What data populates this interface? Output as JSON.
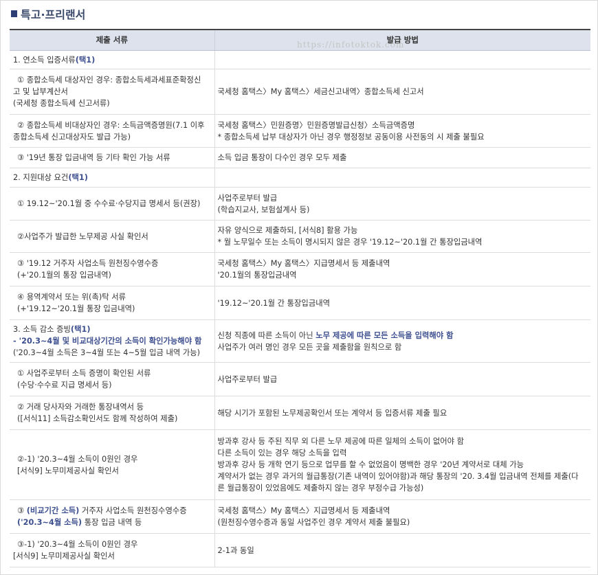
{
  "title": "특고·프리랜서",
  "watermark": "https://infotoktok.com",
  "headers": [
    "제출 서류",
    "발급 방법"
  ],
  "sections": {
    "s1": {
      "label_a": "1. 연소득 입증서류",
      "label_b": "(택1)",
      "rows": [
        {
          "left": [
            "① 종합소득세 대상자인 경우: 종합소득세과세표준확정신",
            "고 및 납부계산서",
            "(국세청 종합소득세 신고서류)"
          ],
          "right": [
            "국세청 홈택스〉My 홈택스〉세금신고내역〉종합소득세 신고서"
          ]
        },
        {
          "left": [
            "② 종합소득세 비대상자인 경우: 소득금액증명원(7.1 이후",
            "종합소득세 신고대상자도 발급 가능)"
          ],
          "right": [
            "국세청 홈택스〉민원증명〉민원증명발급신청〉소득금액증명",
            "* 종합소득세 납부 대상자가 아닌 경우 행정정보 공동이용 사전동의 시 제출 불필요"
          ]
        },
        {
          "left": [
            "③ '19년 통장 입금내역 등 기타 확인 가능 서류"
          ],
          "right": [
            "소득 입금 통장이 다수인 경우 모두 제출"
          ]
        }
      ]
    },
    "s2": {
      "label_a": "2. 지원대상 요건",
      "label_b": "(택1)",
      "rows": [
        {
          "left": [
            "① 19.12~'20.1월 중 수수료·수당지급 명세서 등(권장)"
          ],
          "right": [
            "사업주로부터 발급",
            "(학습지교사, 보험설계사 등)"
          ]
        },
        {
          "left": [
            "②사업주가 발급한 노무제공 사실 확인서"
          ],
          "right": [
            "자유 양식으로 제출하되, [서식8] 활용 가능",
            "* 월 노무일수 또는 소득이 명시되지 않은 경우 '19.12~'20.1월 간 통장입금내역"
          ]
        },
        {
          "left": [
            "③ '19.12 거주자 사업소득 원천징수영수증",
            "(+'20.1월의 통장 입금내역)"
          ],
          "right": [
            "국세청 홈택스〉My 홈택스〉지급명세서 등 제출내역",
            "'20.1월의 통장입금내역"
          ]
        },
        {
          "left": [
            "④ 용역계약서 또는 위(촉)탁 서류",
            "(+'19.12~'20.1월 통장 입금내역)"
          ],
          "right": [
            "'19.12~'20.1월 간 통장입금내역"
          ]
        }
      ]
    },
    "s3": {
      "label_a": "3. 소득 감소 증빙",
      "label_b": "(택1)",
      "sub_blue": "- '20.3~4월 및 비교대상기간의 소득이 확인가능해야 함",
      "sub_gray": "('20.3~4월 소득은 3~4월 또는 4~5월 입금 내역 가능)",
      "right_a": "신청 직종에 따른 소득이 아닌 ",
      "right_b": "노무 제공에 따른 모든 소득을 입력해야 함",
      "right_c": "사업주가 여러 명인 경우 모든 곳을 제출함을 원칙으로 함",
      "rows": [
        {
          "left": [
            "① 사업주로부터 소득 증명이 확인된 서류",
            "(수당·수수료 지급 명세서 등)"
          ],
          "right": [
            "사업주로부터 발급"
          ]
        },
        {
          "left": [
            "② 거래 당사자와 거래한 통장내역서 등",
            "([서식11] 소득감소확인서도 함께 작성하여 제출)"
          ],
          "right": [
            "해당 시기가 포함된 노무제공확인서 또는 계약서 등 입증서류 제출 필요"
          ]
        },
        {
          "left": [
            "②-1) '20.3~4월 소득이 0원인 경우",
            "[서식9] 노무미제공사실 확인서"
          ],
          "right": [
            "방과후 강사 등 주된 직무 외 다른 노무 제공에 따른 일체의 소득이 없어야 함",
            "다른 소득이 있는 경우 해당 소득을 입력",
            "방과후 강사 등 개학 연기 등으로 업무를 할 수 없었음이 명백한 경우 '20년 계약서로 대체 가능",
            "계약서가 없는 경우 과거의 월급통장(기존 내역이 있어야함)과 해당 통장의 '20. 3.4월 입금내역 전체를 제출(다",
            "른 월급통장이 있었음에도 제출하지 않는 경우 부정수급 가능성)"
          ]
        }
      ],
      "row4": {
        "l1a": "③ ",
        "l1b": "(비교기간 소득)",
        "l1c": " 거주자 사업소득 원천징수영수증",
        "l2a": "('20.3~4월 소득)",
        "l2b": " 통장 입금 내역 등",
        "right": [
          "국세청 홈택스〉My 홈택스〉지급명세서 등 제출내역",
          "(원천징수영수증과 동일 사업주인 경우 계약서 제출 불필요)"
        ]
      },
      "row5": {
        "left": [
          "③-1) '20.3~4월 소득이 0원인 경우",
          "[서식9] 노무미제공사실 확인서"
        ],
        "right": [
          "2-1과 동일"
        ]
      }
    }
  }
}
